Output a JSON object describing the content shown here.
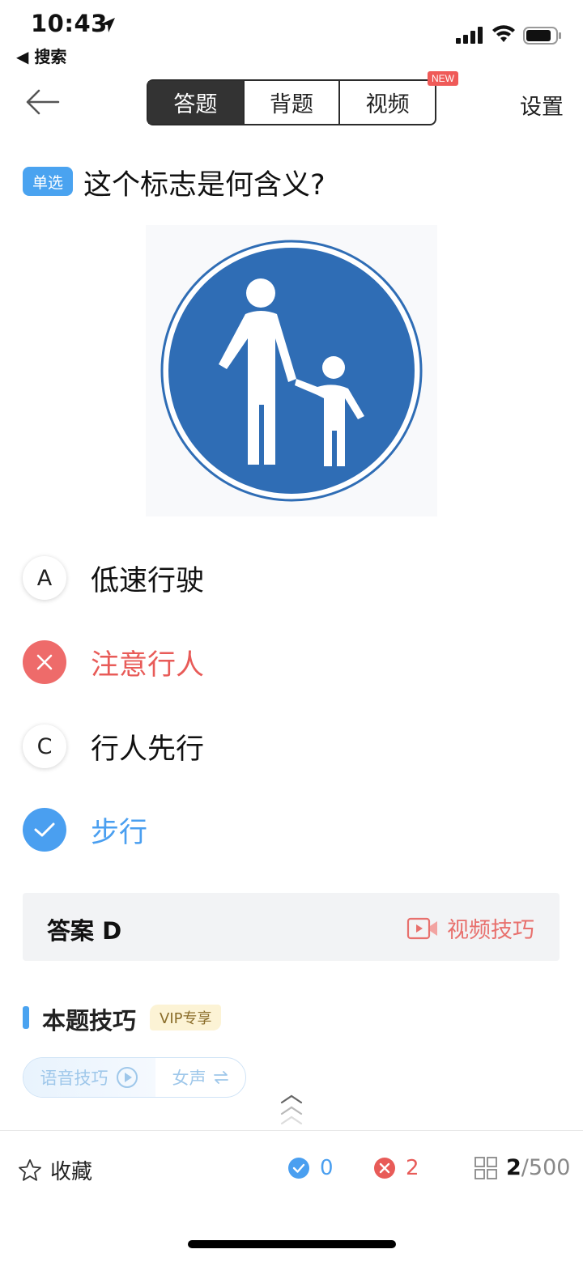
{
  "status_bar": {
    "time": "10:43",
    "back_label": "◀ 搜索"
  },
  "nav": {
    "tabs": [
      {
        "label": "答题",
        "active": true
      },
      {
        "label": "背题",
        "active": false
      },
      {
        "label": "视频",
        "active": false
      }
    ],
    "new_badge": "NEW",
    "settings": "设置"
  },
  "question": {
    "type_tag": "单选",
    "text": "这个标志是何含义?"
  },
  "options": [
    {
      "letter": "A",
      "text": "低速行驶",
      "state": "normal"
    },
    {
      "letter": "B",
      "text": "注意行人",
      "state": "wrong"
    },
    {
      "letter": "C",
      "text": "行人先行",
      "state": "normal"
    },
    {
      "letter": "D",
      "text": "步行",
      "state": "correct"
    }
  ],
  "answer": {
    "text": "答案 D",
    "video_tip": "视频技巧"
  },
  "tips": {
    "title": "本题技巧",
    "vip_badge": "VIP专享",
    "voice_tip": "语音技巧",
    "voice_gender": "女声"
  },
  "bottom_bar": {
    "favorite": "收藏",
    "correct_count": "0",
    "wrong_count": "2",
    "current": "2",
    "total": "/500"
  },
  "colors": {
    "accent_blue": "#4a9ff0",
    "error_red": "#e85b58",
    "sign_blue": "#2f6db5"
  }
}
